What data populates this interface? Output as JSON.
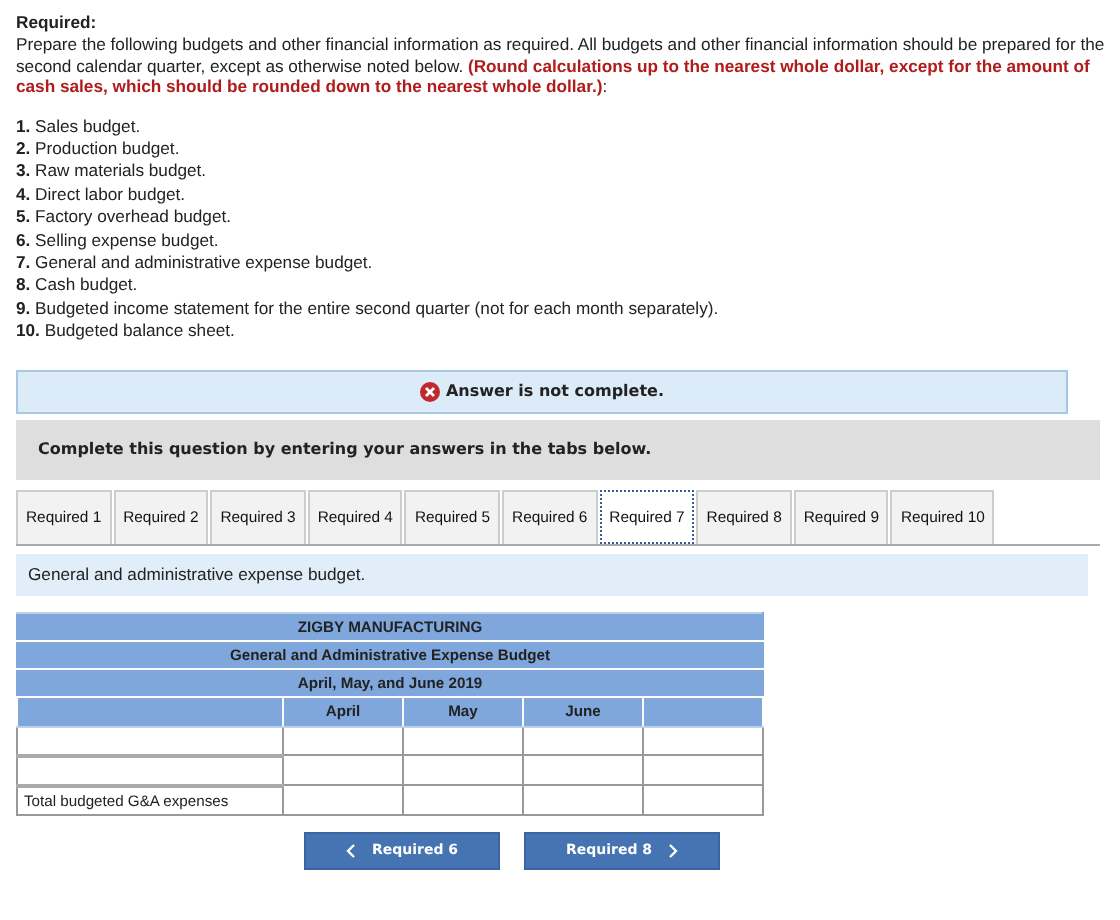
{
  "required_heading": "Required:",
  "intro": "Prepare the following budgets and other financial information as required. All budgets and other financial information should be prepared for the second calendar quarter, except as otherwise noted below. **(Round calculations up to the nearest whole dollar, except for the amount of cash sales, which should be rounded down to the nearest whole dollar.)**:",
  "items": [
    "**1.** Sales budget.",
    "**2.** Production budget.",
    "**3.** Raw materials budget.",
    "**4.** Direct labor budget.",
    "**5.** Factory overhead budget.",
    "**6.** Selling expense budget.",
    "**7.** General and administrative expense budget.",
    "**8.** Cash budget.",
    "**9.** Budgeted income statement for the entire second quarter (not for each month separately).",
    "**10.** Budgeted balance sheet."
  ],
  "alert": {
    "text": "Answer is not complete."
  },
  "instruction": "Complete this question by entering your answers in the tabs below.",
  "tabs": [
    {
      "label": "Required 1",
      "selected": false
    },
    {
      "label": "Required 2",
      "selected": false
    },
    {
      "label": "Required 3",
      "selected": false
    },
    {
      "label": "Required 4",
      "selected": false
    },
    {
      "label": "Required 5",
      "selected": false
    },
    {
      "label": "Required 6",
      "selected": false
    },
    {
      "label": "Required 7",
      "selected": true
    },
    {
      "label": "Required 8",
      "selected": false
    },
    {
      "label": "Required 9",
      "selected": false
    },
    {
      "label": "Required 10",
      "selected": false
    }
  ],
  "tab_prompt": "General and administrative expense budget.",
  "table": {
    "titles": [
      "ZIGBY MANUFACTURING",
      "General and Administrative Expense Budget",
      "April, May, and June 2019"
    ],
    "columns": [
      "April",
      "May",
      "June"
    ],
    "rows": [
      {
        "kind": "input"
      },
      {
        "kind": "input"
      },
      {
        "kind": "total",
        "label": "Total budgeted G&A expenses"
      }
    ]
  },
  "nav": {
    "previous": "Required 6",
    "next": "Required 8"
  }
}
